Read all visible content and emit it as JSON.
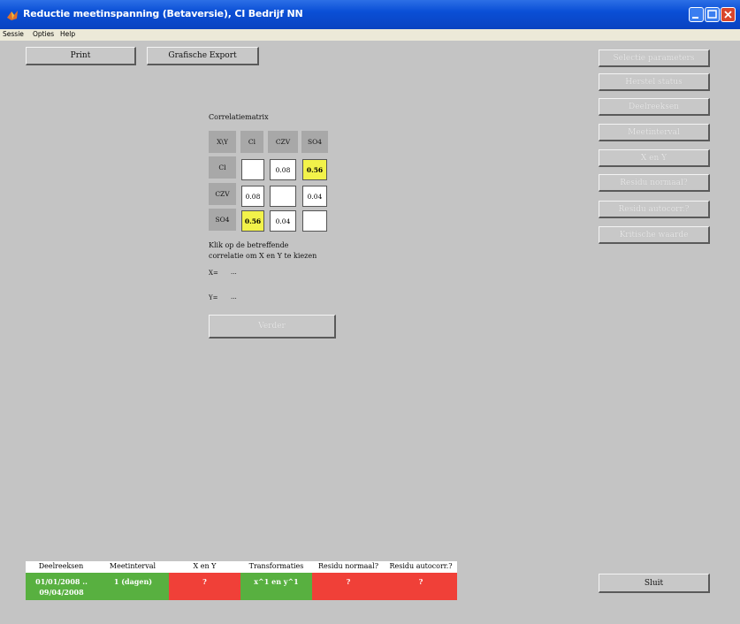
{
  "window": {
    "title": "Reductie meetinspanning (Betaversie), CI Bedrijf NN"
  },
  "menu": {
    "items": [
      "Sessie",
      "Opties",
      "Help"
    ]
  },
  "toolbar": {
    "print": "Print",
    "export": "Grafische Export"
  },
  "right_panel": {
    "buttons": [
      "Selectie parameters",
      "Herstel status",
      "Deelreeksen",
      "Meetinterval",
      "X en Y",
      "Residu normaal?",
      "Residu autocorr.?",
      "Kritische waarde"
    ],
    "close": "Sluit"
  },
  "matrix": {
    "title": "Correlatiematrix",
    "headers": [
      "X\\Y",
      "Cl",
      "CZV",
      "SO4"
    ],
    "rows": [
      {
        "label": "Cl",
        "values": [
          "",
          "0.08",
          "0.56"
        ]
      },
      {
        "label": "CZV",
        "values": [
          "0.08",
          "",
          "0.04"
        ]
      },
      {
        "label": "SO4",
        "values": [
          "0.56",
          "0.04",
          ""
        ]
      }
    ],
    "instruction_line1": "Klik op de betreffende",
    "instruction_line2": "correlatie om X en Y te kiezen",
    "x_label": "X=",
    "x_value": "...",
    "y_label": "Y=",
    "y_value": "...",
    "next_button": "Verder"
  },
  "status": {
    "headers": [
      "Deelreeksen",
      "Meetinterval",
      "X en Y",
      "Transformaties",
      "Residu normaal?",
      "Residu autocorr.?"
    ],
    "values": [
      "01/01/2008 .. 09/04/2008",
      "1 (dagen)",
      "?",
      "x^1 en y^1",
      "?",
      "?"
    ],
    "value_line1": "01/01/2008 ..",
    "value_line2": "09/04/2008",
    "colors": {
      "ok": "#58b040",
      "bad": "#f04038"
    }
  }
}
